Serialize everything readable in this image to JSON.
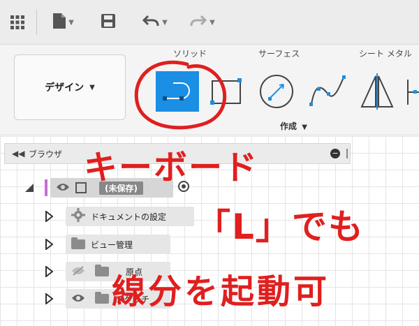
{
  "toolbar": {
    "grid_icon": "app-grid-icon",
    "file_icon": "file-icon",
    "save_icon": "save-icon",
    "undo_icon": "undo-icon",
    "redo_icon": "redo-icon"
  },
  "ribbon": {
    "workspace_label": "デザイン",
    "tabs": [
      {
        "label": "ソリッド"
      },
      {
        "label": "サーフェス"
      },
      {
        "label": "シート メタル"
      }
    ],
    "tools": [
      {
        "name": "line-tool",
        "icon": "line-tool-icon",
        "active": true
      },
      {
        "name": "rectangle-tool",
        "icon": "rectangle-icon",
        "active": false
      },
      {
        "name": "circle-tool",
        "icon": "circle-icon",
        "active": false
      },
      {
        "name": "spline-tool",
        "icon": "spline-icon",
        "active": false
      },
      {
        "name": "mirror-tool",
        "icon": "mirror-icon",
        "active": false
      }
    ],
    "create_label": "作成",
    "colors": {
      "accent": "#1a8fe3",
      "annotation": "#e01f1f"
    }
  },
  "browser": {
    "title": "ブラウザ",
    "root_label": "(未保存)",
    "items": [
      {
        "label": "ドキュメントの設定",
        "icon": "gear-icon"
      },
      {
        "label": "ビュー管理",
        "icon": "folder-icon"
      },
      {
        "label": "原点",
        "icon": "folder-icon"
      },
      {
        "label": "スケッチ",
        "icon": "folder-icon"
      }
    ]
  },
  "annotation": {
    "line1": "キーボード",
    "line2": "「L」でも",
    "line3": "線分を起動可"
  }
}
